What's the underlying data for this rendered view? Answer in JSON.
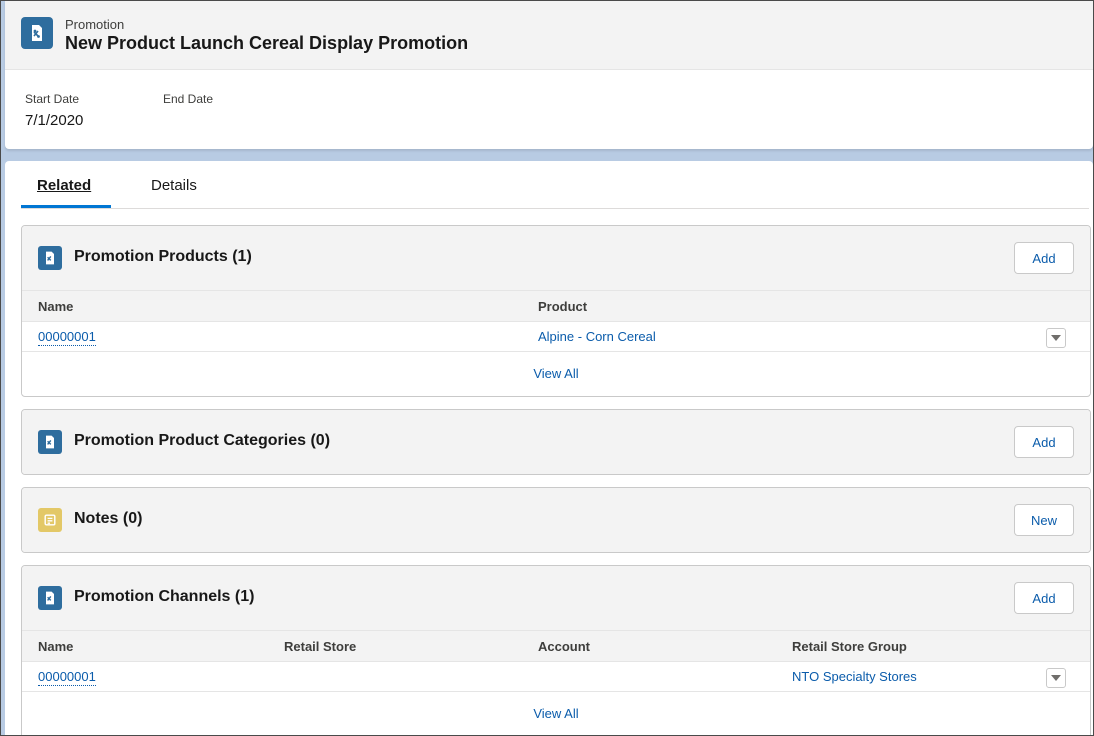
{
  "header": {
    "object_type": "Promotion",
    "title": "New Product Launch Cereal Display Promotion",
    "fields": [
      {
        "label": "Start Date",
        "value": "7/1/2020"
      },
      {
        "label": "End Date",
        "value": ""
      }
    ]
  },
  "tabs": [
    {
      "label": "Related",
      "active": true
    },
    {
      "label": "Details",
      "active": false
    }
  ],
  "promotion_products": {
    "title": "Promotion Products (1)",
    "button": "Add",
    "columns": [
      "Name",
      "Product"
    ],
    "rows": [
      {
        "name": "00000001",
        "product": "Alpine - Corn Cereal"
      }
    ],
    "view_all": "View All"
  },
  "promotion_product_categories": {
    "title": "Promotion Product Categories (0)",
    "button": "Add"
  },
  "notes": {
    "title": "Notes (0)",
    "button": "New"
  },
  "promotion_channels": {
    "title": "Promotion Channels (1)",
    "button": "Add",
    "columns": [
      "Name",
      "Retail Store",
      "Account",
      "Retail Store Group"
    ],
    "rows": [
      {
        "name": "00000001",
        "retail_store": "",
        "account": "",
        "retail_store_group": "NTO Specialty Stores"
      }
    ],
    "view_all": "View All"
  },
  "colors": {
    "brand_blue": "#0176d3",
    "link_blue": "#0b5cab",
    "promotion_icon": "#2e6d9e",
    "notes_icon": "#e3c867"
  }
}
